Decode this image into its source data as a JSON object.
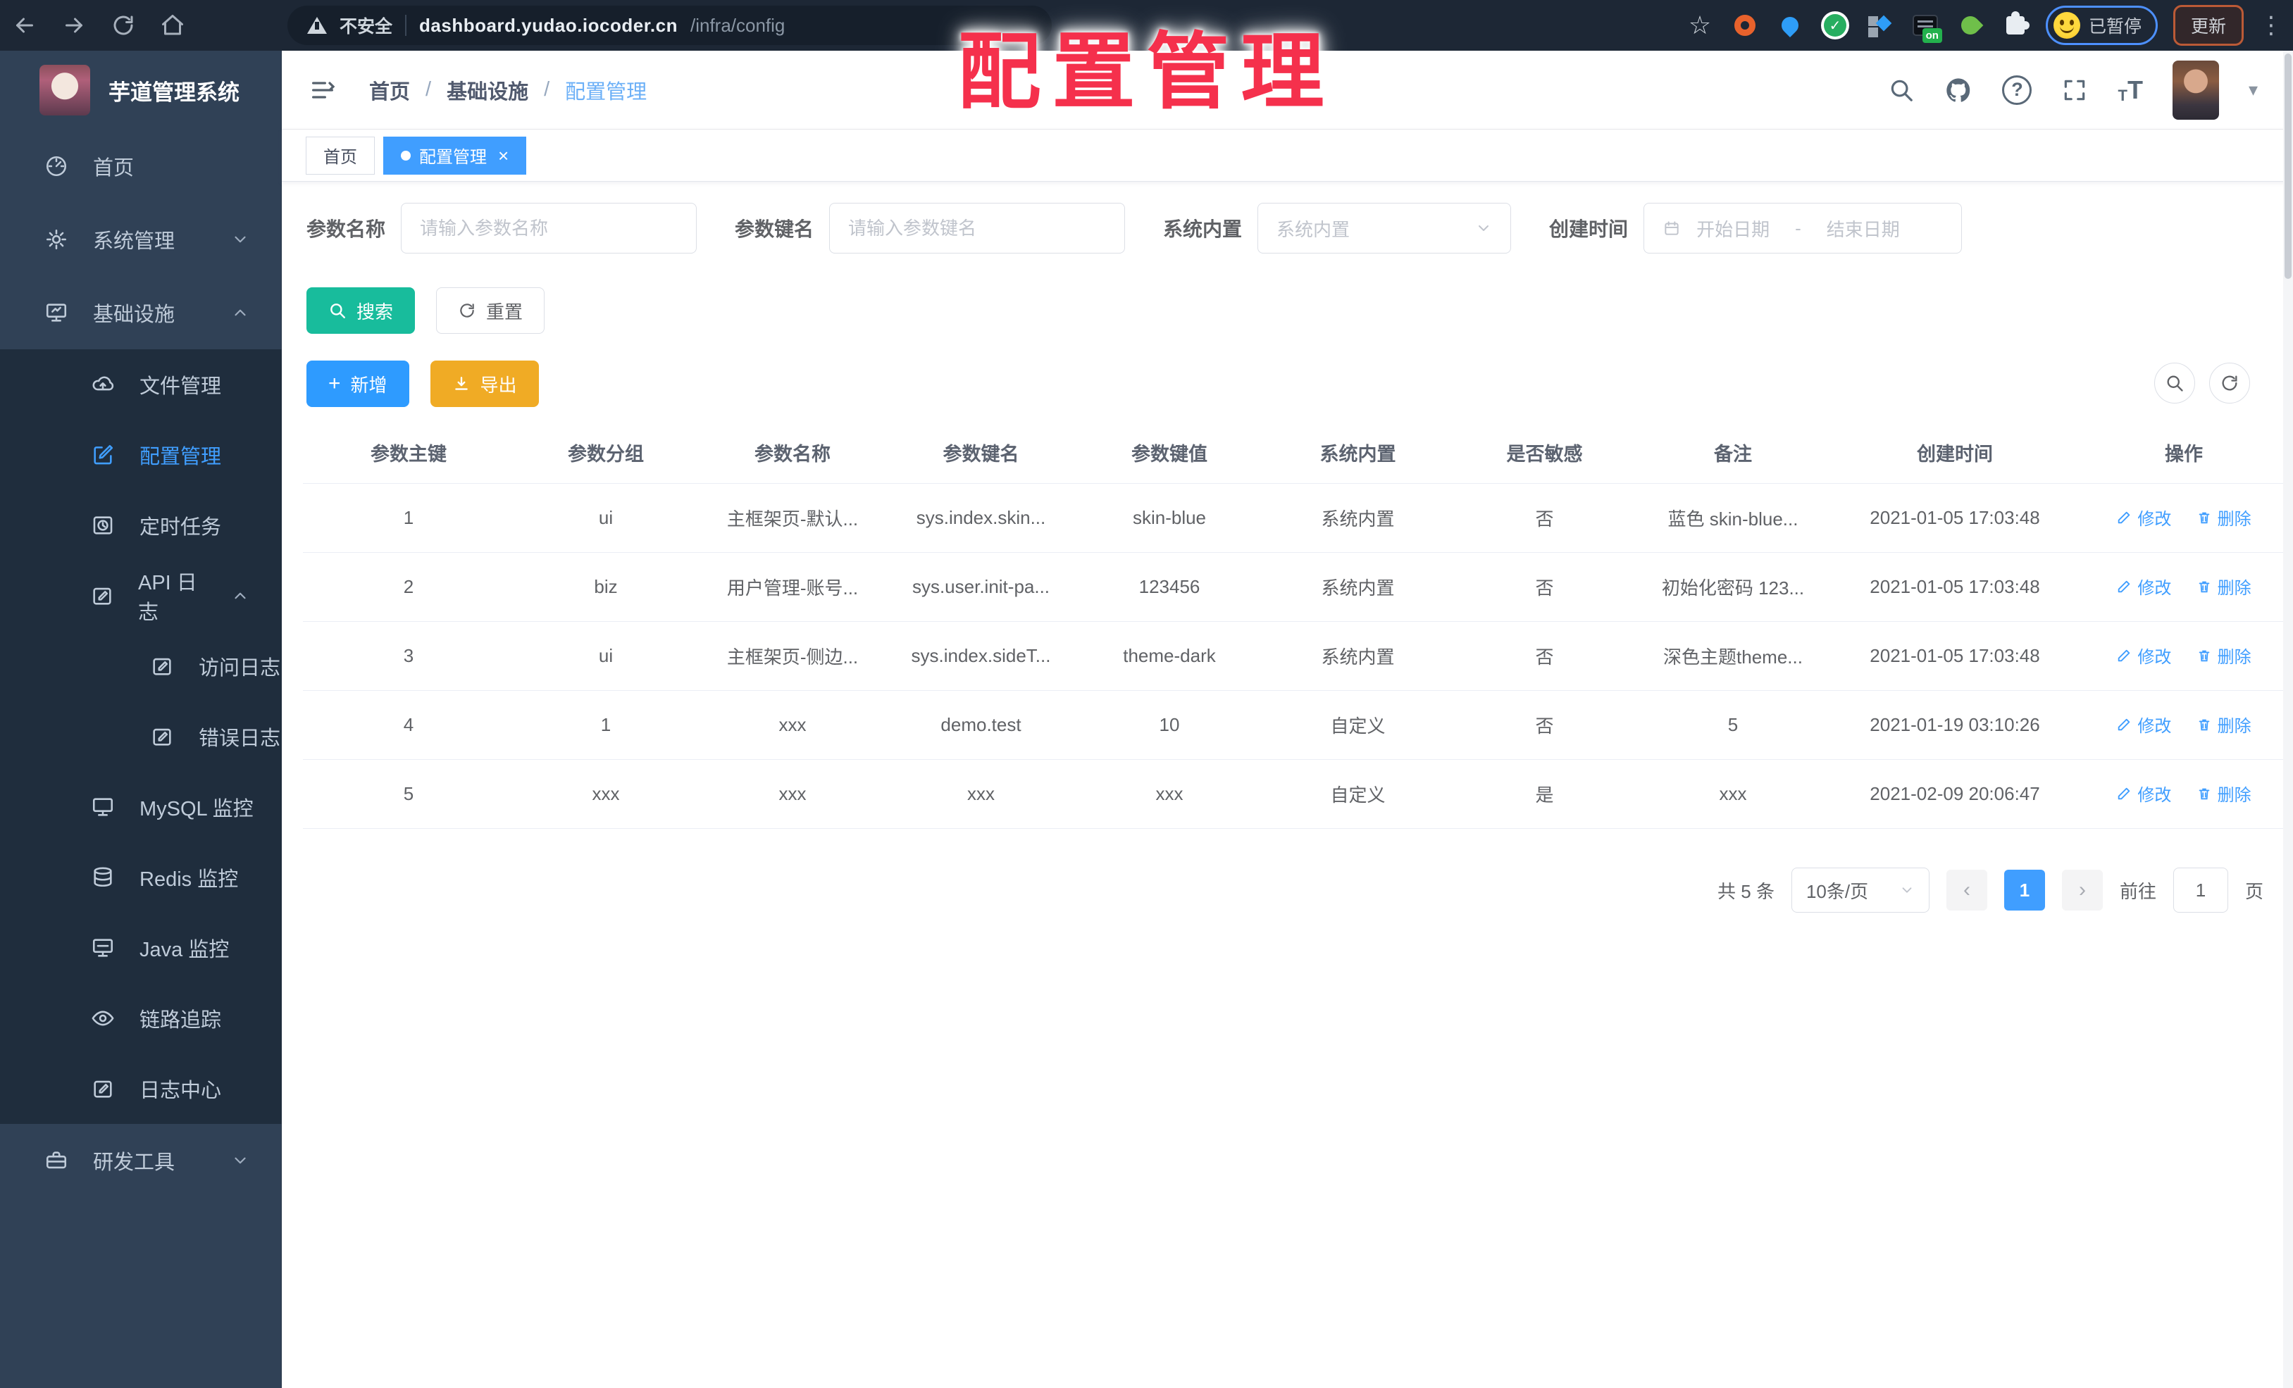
{
  "annotation": {
    "title": "配置管理"
  },
  "browser": {
    "security": "不安全",
    "host": "dashboard.yudao.iocoder.cn",
    "path": "/infra/config",
    "on_badge": "on",
    "check_glyph": "✓",
    "paused_chip": "已暂停",
    "update_button": "更新"
  },
  "glyphs": {
    "star": "☆",
    "kebab": "⋮",
    "caret": "▾",
    "question": "?",
    "close": "×",
    "plus": "+",
    "prev": "‹",
    "next": "›",
    "t_small": "T",
    "t_big": "T"
  },
  "sidebar": {
    "title": "芋道管理系统",
    "items": [
      {
        "label": "首页",
        "icon": "gauge-icon"
      },
      {
        "label": "系统管理",
        "icon": "gear-icon",
        "chevron": "down"
      },
      {
        "label": "基础设施",
        "icon": "monitor-icon",
        "chevron": "up"
      },
      {
        "label": "文件管理",
        "icon": "cloud-upload-icon"
      },
      {
        "label": "配置管理",
        "icon": "edit-icon",
        "active": true
      },
      {
        "label": "定时任务",
        "icon": "clock-icon"
      },
      {
        "label": "API 日志",
        "icon": "log-icon",
        "chevron": "up"
      },
      {
        "label": "访问日志",
        "icon": "log-icon"
      },
      {
        "label": "错误日志",
        "icon": "log-icon"
      },
      {
        "label": "MySQL 监控",
        "icon": "monitor-icon"
      },
      {
        "label": "Redis 监控",
        "icon": "database-icon"
      },
      {
        "label": "Java 监控",
        "icon": "monitor-icon"
      },
      {
        "label": "链路追踪",
        "icon": "eye-icon"
      },
      {
        "label": "日志中心",
        "icon": "log-icon"
      },
      {
        "label": "研发工具",
        "icon": "toolbox-icon",
        "chevron": "down"
      }
    ]
  },
  "breadcrumb": {
    "items": [
      "首页",
      "基础设施",
      "配置管理"
    ],
    "separator": "/"
  },
  "tabs": [
    {
      "label": "首页",
      "active": false
    },
    {
      "label": "配置管理",
      "active": true
    }
  ],
  "filters": {
    "name_label": "参数名称",
    "name_placeholder": "请输入参数名称",
    "key_label": "参数键名",
    "key_placeholder": "请输入参数键名",
    "type_label": "系统内置",
    "type_placeholder": "系统内置",
    "date_label": "创建时间",
    "date_start": "开始日期",
    "date_separator": "-",
    "date_end": "结束日期"
  },
  "buttons": {
    "search": "搜索",
    "reset": "重置",
    "add": "新增",
    "export": "导出"
  },
  "table": {
    "columns": [
      "参数主键",
      "参数分组",
      "参数名称",
      "参数键名",
      "参数键值",
      "系统内置",
      "是否敏感",
      "备注",
      "创建时间",
      "操作"
    ],
    "rows": [
      {
        "id": "1",
        "group": "ui",
        "name": "主框架页-默认...",
        "key": "sys.index.skin...",
        "value": "skin-blue",
        "type": "系统内置",
        "sensitive": "否",
        "remark": "蓝色 skin-blue...",
        "created": "2021-01-05 17:03:48"
      },
      {
        "id": "2",
        "group": "biz",
        "name": "用户管理-账号...",
        "key": "sys.user.init-pa...",
        "value": "123456",
        "type": "系统内置",
        "sensitive": "否",
        "remark": "初始化密码 123...",
        "created": "2021-01-05 17:03:48"
      },
      {
        "id": "3",
        "group": "ui",
        "name": "主框架页-侧边...",
        "key": "sys.index.sideT...",
        "value": "theme-dark",
        "type": "系统内置",
        "sensitive": "否",
        "remark": "深色主题theme...",
        "created": "2021-01-05 17:03:48"
      },
      {
        "id": "4",
        "group": "1",
        "name": "xxx",
        "key": "demo.test",
        "value": "10",
        "type": "自定义",
        "sensitive": "否",
        "remark": "5",
        "created": "2021-01-19 03:10:26"
      },
      {
        "id": "5",
        "group": "xxx",
        "name": "xxx",
        "key": "xxx",
        "value": "xxx",
        "type": "自定义",
        "sensitive": "是",
        "remark": "xxx",
        "created": "2021-02-09 20:06:47"
      }
    ],
    "edit_label": "修改",
    "delete_label": "删除"
  },
  "pagination": {
    "total": "共 5 条",
    "size": "10条/页",
    "page": "1",
    "goto": "前往",
    "goto_value": "1",
    "unit": "页"
  },
  "colors": {
    "accent": "#409EFF",
    "success": "#18BC9C",
    "warning": "#F0AB25",
    "sidebar": "#304156",
    "submenu": "#1F2D3D",
    "annotation": "#F5304C"
  }
}
